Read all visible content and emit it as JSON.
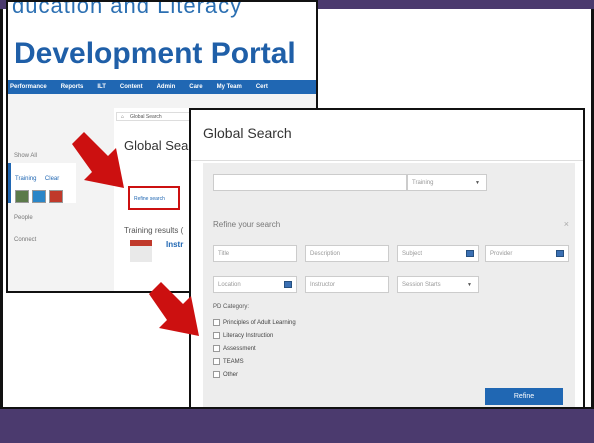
{
  "back": {
    "subtitle": "ducation and Literacy",
    "title": "Development Portal",
    "nav": [
      "Performance",
      "Reports",
      "ILT",
      "Content",
      "Admin",
      "Care",
      "My Team",
      "Cert"
    ],
    "breadcrumb": "Global Search",
    "search_title": "Global Sear",
    "refine_link": "Refine search",
    "results_label": "Training results (",
    "result_title": "Instr",
    "sidebar": {
      "show_all": "Show All",
      "training": "Training",
      "training_clear": "Clear",
      "people": "People",
      "connect": "Connect"
    }
  },
  "modal": {
    "title": "Global Search",
    "search_type": "Training",
    "refine_heading": "Refine your search",
    "close_glyph": "×",
    "fields": {
      "title": "Title",
      "description": "Description",
      "subject": "Subject",
      "provider": "Provider",
      "location": "Location",
      "instructor": "Instructor",
      "session_starts": "Session Starts"
    },
    "pd_category_label": "PD Category:",
    "categories": [
      "Principles of Adult Learning",
      "Literacy Instruction",
      "Assessment",
      "TEAMS",
      "Other"
    ],
    "refine_button": "Refine"
  },
  "colors": {
    "brand_purple": "#4b3a6e",
    "portal_blue": "#1f5fa8",
    "arrow_red": "#cc1010",
    "button_blue": "#2067b3"
  }
}
